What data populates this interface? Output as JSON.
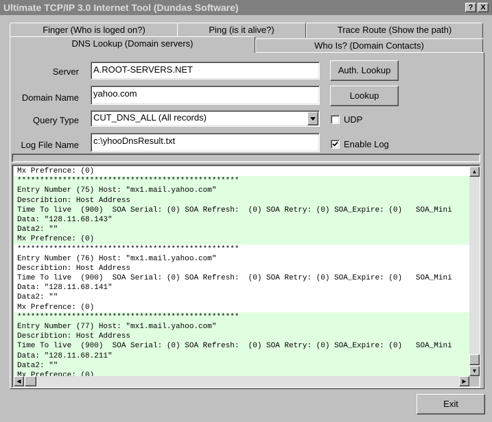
{
  "window": {
    "title": "Ultimate TCP/IP 3.0 Internet Tool (Dundas Software)",
    "help_btn": "?",
    "close_btn": "X"
  },
  "tabs": {
    "finger": "Finger (Who is loged on?)",
    "ping": "Ping (is it alive?)",
    "trace": "Trace Route (Show the path)",
    "dns": "DNS Lookup (Domain servers)",
    "whois": "Who Is? (Domain Contacts)"
  },
  "form": {
    "server_label": "Server",
    "server_value": "A.ROOT-SERVERS.NET",
    "domain_label": "Domain Name",
    "domain_value": "yahoo.com",
    "query_label": "Query Type",
    "query_value": "CUT_DNS_ALL (All records)",
    "logfile_label": "Log File Name",
    "logfile_value": "c:\\yhooDnsResult.txt"
  },
  "buttons": {
    "auth_lookup": "Auth. Lookup",
    "lookup": "Lookup",
    "exit": "Exit"
  },
  "options": {
    "udp_label": "UDP",
    "udp_checked": false,
    "enable_log_label": "Enable Log",
    "enable_log_checked": true
  },
  "log": {
    "lines": [
      {
        "text": "Mx Prefrence: (0)",
        "shade": false
      },
      {
        "text": "*************************************************",
        "shade": true
      },
      {
        "text": "Entry Number (75) Host: \"mx1.mail.yahoo.com\"",
        "shade": true
      },
      {
        "text": "Describtion: Host Address",
        "shade": true
      },
      {
        "text": "Time To live  (900)  SOA Serial: (0) SOA Refresh:  (0) SOA Retry: (0) SOA_Expire: (0)   SOA_Mini",
        "shade": true
      },
      {
        "text": "Data: \"128.11.68.143\"",
        "shade": true
      },
      {
        "text": "Data2: \"\"",
        "shade": true
      },
      {
        "text": "Mx Prefrence: (0)",
        "shade": true
      },
      {
        "text": "*************************************************",
        "shade": false
      },
      {
        "text": "Entry Number (76) Host: \"mx1.mail.yahoo.com\"",
        "shade": false
      },
      {
        "text": "Describtion: Host Address",
        "shade": false
      },
      {
        "text": "Time To live  (900)  SOA Serial: (0) SOA Refresh:  (0) SOA Retry: (0) SOA_Expire: (0)   SOA_Mini",
        "shade": false
      },
      {
        "text": "Data: \"128.11.68.141\"",
        "shade": false
      },
      {
        "text": "Data2: \"\"",
        "shade": false
      },
      {
        "text": "Mx Prefrence: (0)",
        "shade": false
      },
      {
        "text": "*************************************************",
        "shade": true
      },
      {
        "text": "Entry Number (77) Host: \"mx1.mail.yahoo.com\"",
        "shade": true
      },
      {
        "text": "Describtion: Host Address",
        "shade": true
      },
      {
        "text": "Time To live  (900)  SOA Serial: (0) SOA Refresh:  (0) SOA Retry: (0) SOA_Expire: (0)   SOA_Mini",
        "shade": true
      },
      {
        "text": "Data: \"128.11.68.211\"",
        "shade": true
      },
      {
        "text": "Data2: \"\"",
        "shade": true
      },
      {
        "text": "Mx Prefrence: (0)",
        "shade": true
      }
    ]
  },
  "icons": {
    "up": "arrow-up-icon",
    "down": "arrow-down-icon",
    "left": "arrow-left-icon",
    "right": "arrow-right-icon",
    "dropdown": "dropdown-arrow-icon"
  },
  "colors": {
    "titlebar": "#808080",
    "face": "#c0c0c0",
    "log_shade": "#e0ffe0"
  }
}
